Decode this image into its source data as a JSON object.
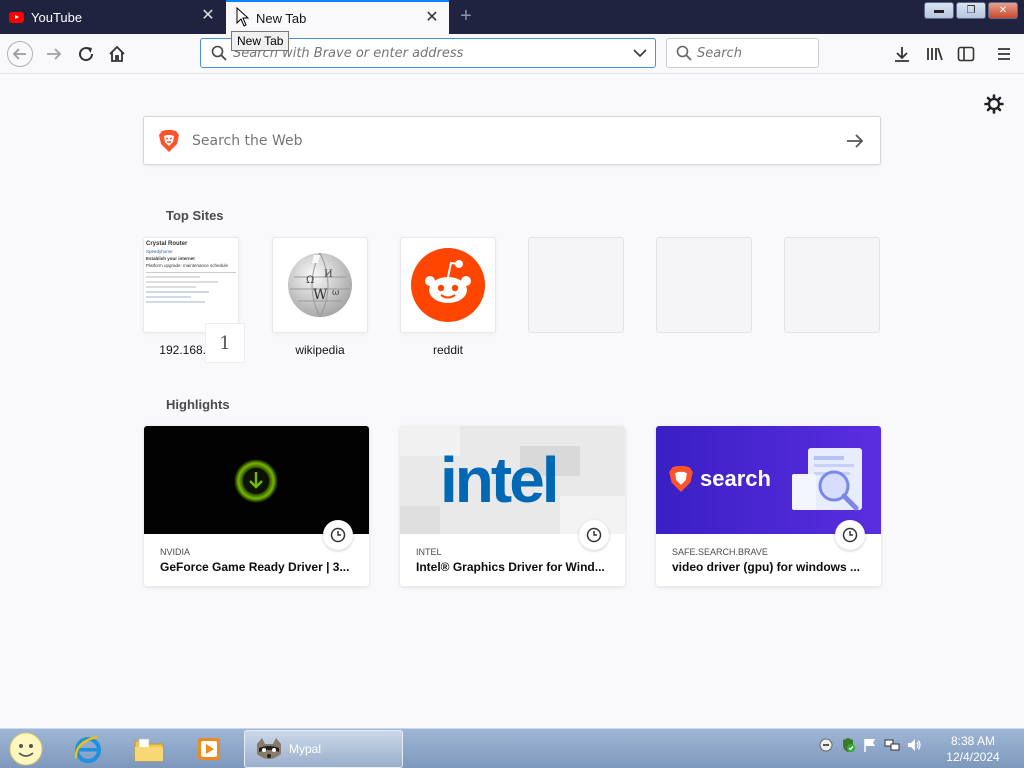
{
  "tabs": [
    {
      "title": "YouTube",
      "active": false
    },
    {
      "title": "New Tab",
      "active": true
    }
  ],
  "tooltip": "New Tab",
  "window_controls": [
    "minimize",
    "maximize",
    "close"
  ],
  "navbar": {
    "address_placeholder": "Search with Brave or enter address",
    "search_placeholder": "Search"
  },
  "newtab": {
    "web_search_placeholder": "Search the Web",
    "top_sites_title": "Top Sites",
    "top_sites": [
      {
        "label": "192.168.1.1",
        "badge": "1"
      },
      {
        "label": "wikipedia"
      },
      {
        "label": "reddit"
      },
      {
        "label": ""
      },
      {
        "label": ""
      },
      {
        "label": ""
      }
    ],
    "thumb_192": {
      "heading": "Crystal Router",
      "lines": [
        "Speedyhome",
        "Establish your internet",
        "Platform upgrade: maintenance schedule"
      ]
    },
    "highlights_title": "Highlights",
    "highlights": [
      {
        "source": "NVIDIA",
        "title": "GeForce Game Ready Driver | 3..."
      },
      {
        "source": "INTEL",
        "title": "Intel® Graphics Driver for Wind...",
        "thumb_text": "intel"
      },
      {
        "source": "SAFE.SEARCH.BRAVE",
        "title": "video driver (gpu) for windows ...",
        "thumb_text": "search"
      }
    ]
  },
  "taskbar": {
    "active_task": "Mypal",
    "time": "8:38 AM",
    "date": "12/4/2024"
  },
  "colors": {
    "tabstrip": "#202340",
    "accent": "#0a84ff",
    "brave_orange": "#fb542b",
    "reddit_orange": "#ff4500",
    "brave_search_purple": "#4b2ad8"
  }
}
